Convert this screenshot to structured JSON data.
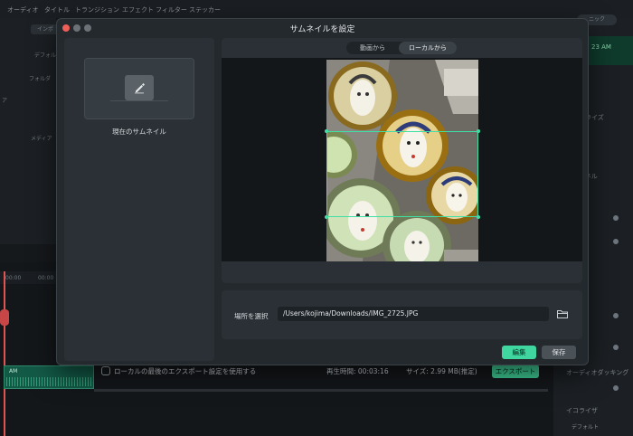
{
  "toolbar": {
    "items": [
      "オーディオ",
      "タイトル",
      "トランジション",
      "エフェクト",
      "フィルター",
      "ステッカー"
    ]
  },
  "background": {
    "left_tab": "インポ",
    "left_labels": [
      "デフォルト",
      "フォルダ",
      "ア",
      "メディア"
    ],
    "right_top": "ニック",
    "right_time": "23 AM",
    "right_labels": [
      "ノーマライズ",
      "チャンネル",
      "イン",
      "ウト",
      "オーディオダッキング",
      "イコライザ",
      "デフォルト"
    ],
    "ruler_ticks": [
      "00:00",
      "00:00"
    ],
    "clip_label": "AM"
  },
  "dialog": {
    "title": "サムネイルを設定",
    "current_thumbnail_label": "現在のサムネイル",
    "seg_video": "動画から",
    "seg_local": "ローカルから",
    "location_label": "場所を選択",
    "location_path": "/Users/kojima/Downloads/IMG_2725.JPG",
    "edit_label": "編集",
    "save_label": "保存"
  },
  "export_bar": {
    "checkbox_label": "ローカルの最後のエクスポート設定を使用する",
    "duration_label": "再生時間: 00:03:16",
    "size_label": "サイズ: 2.99 MB(推定)",
    "export_label": "エクスポート"
  },
  "colors": {
    "accent": "#3fd6a0",
    "close": "#ee5f57",
    "minimize": "#6b7177",
    "maximize": "#6b7177"
  }
}
